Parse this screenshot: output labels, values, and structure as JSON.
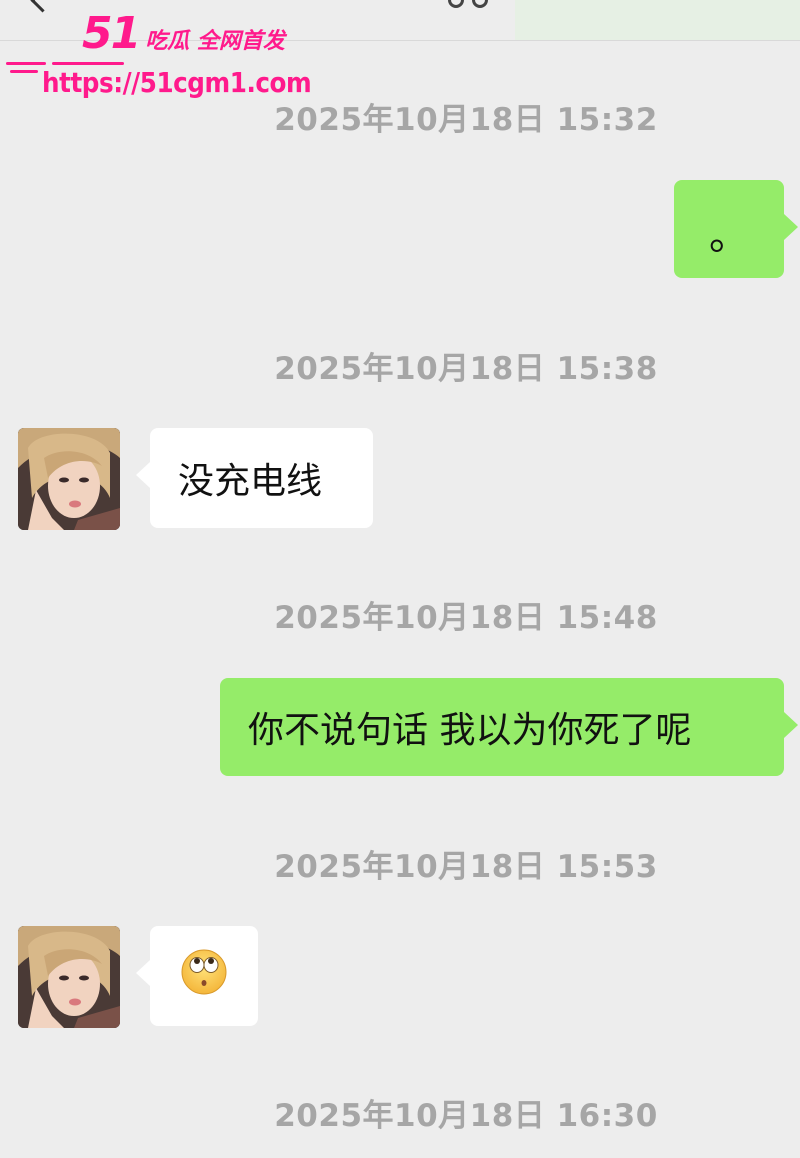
{
  "watermark": {
    "brand_number": "51",
    "brand_text": "吃瓜 全网首发",
    "url": "https://51cgm1.com"
  },
  "messages": [
    {
      "timestamp": "2025年10月18日 15:32",
      "side": "right",
      "text": "。"
    },
    {
      "timestamp": "2025年10月18日 15:38",
      "side": "left",
      "text": "没充电线"
    },
    {
      "timestamp": "2025年10月18日 15:48",
      "side": "right",
      "text": "你不说句话 我以为你死了呢"
    },
    {
      "timestamp": "2025年10月18日 15:53",
      "side": "left",
      "emoji": "eye-roll-emoji"
    },
    {
      "timestamp": "2025年10月18日 16:30"
    }
  ],
  "colors": {
    "background": "#ededed",
    "sent_bubble": "#95ec69",
    "received_bubble": "#ffffff",
    "timestamp_text": "#a6a6a6",
    "watermark": "#ff1a8c"
  }
}
